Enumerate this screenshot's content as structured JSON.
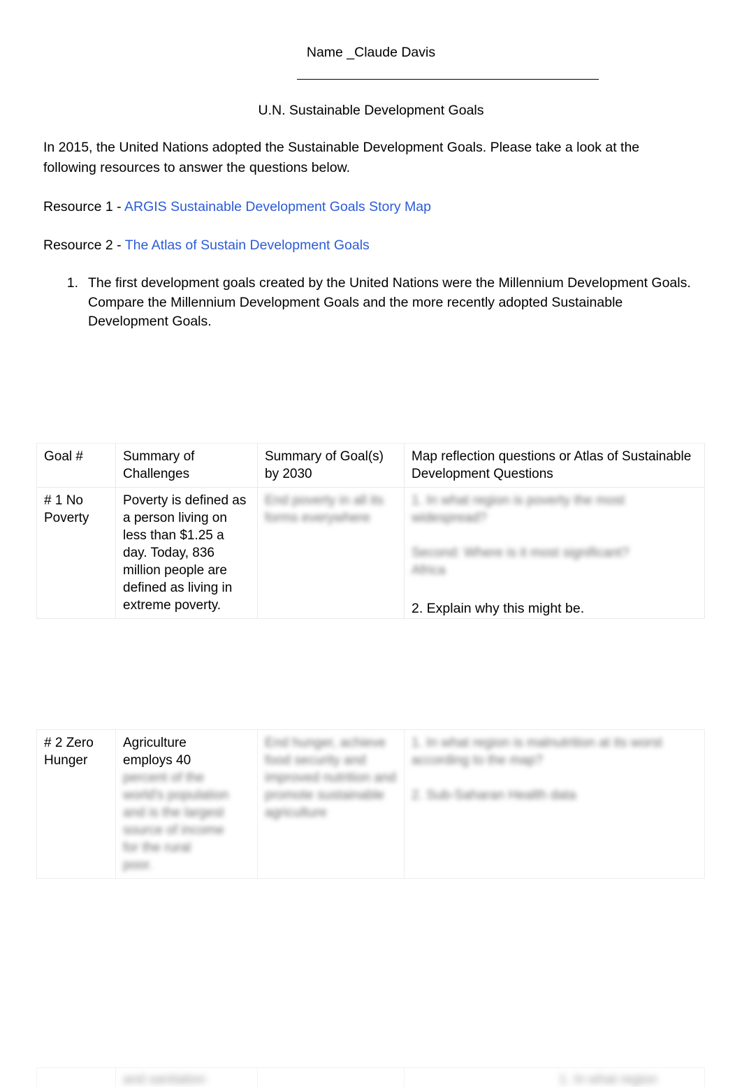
{
  "header": {
    "name_label": "Name _Claude Davis",
    "name_prefix": "Name _Claude",
    "name_suffix": "Davis",
    "title": "U.N. Sustainable Development Goals"
  },
  "intro": {
    "paragraph": "In 2015, the United Nations adopted the Sustainable Development Goals.  Please take a look at the following resources to answer the questions below."
  },
  "resources": [
    {
      "prefix": "Resource 1 - ",
      "link_text": "ARGIS Sustainable Development Goals Story Map"
    },
    {
      "prefix": "Resource 2 - ",
      "link_text": "The Atlas of Sustain Development Goals"
    }
  ],
  "questions": [
    {
      "number": "1.",
      "text": "The first development goals created by the United Nations were the Millennium Development Goals.  Compare the Millennium Development Goals and the more recently adopted Sustainable Development Goals."
    }
  ],
  "table": {
    "headers": [
      "Goal #",
      "Summary of Challenges",
      "Summary of Goal(s) by 2030",
      "Map reflection questions or Atlas of Sustainable Development Questions"
    ],
    "rows": [
      {
        "goal": "# 1 No Poverty",
        "challenges": "Poverty is defined as a person living on less than $1.25 a day. Today, 836 million people are defined as living in extreme poverty.",
        "goals_2030": "End poverty in all its forms everywhere",
        "questions": "1. In what region is poverty the most widespread?\n\nSecond: Where is it most significant?\nAfrica"
      },
      {
        "goal": "# 2 Zero Hunger",
        "challenges": "Agriculture employs 40 percent of the world's population and is the largest source of income for the rural poor.",
        "goals_2030": "End hunger, achieve food security and improved nutrition and promote sustainable agriculture",
        "questions": "1. In what region is malnutrition at its worst according to the map?\n\n2. Sub-Saharan Health data"
      },
      {
        "goal": "",
        "challenges": "",
        "goals_2030": "",
        "questions": ""
      }
    ]
  },
  "row1_note": {
    "text": "2. Explain why this might be."
  },
  "colors": {
    "link": "#2b5bd7",
    "text": "#000000",
    "table_border": "#e9e9e9",
    "page_background": "#ffffff"
  }
}
